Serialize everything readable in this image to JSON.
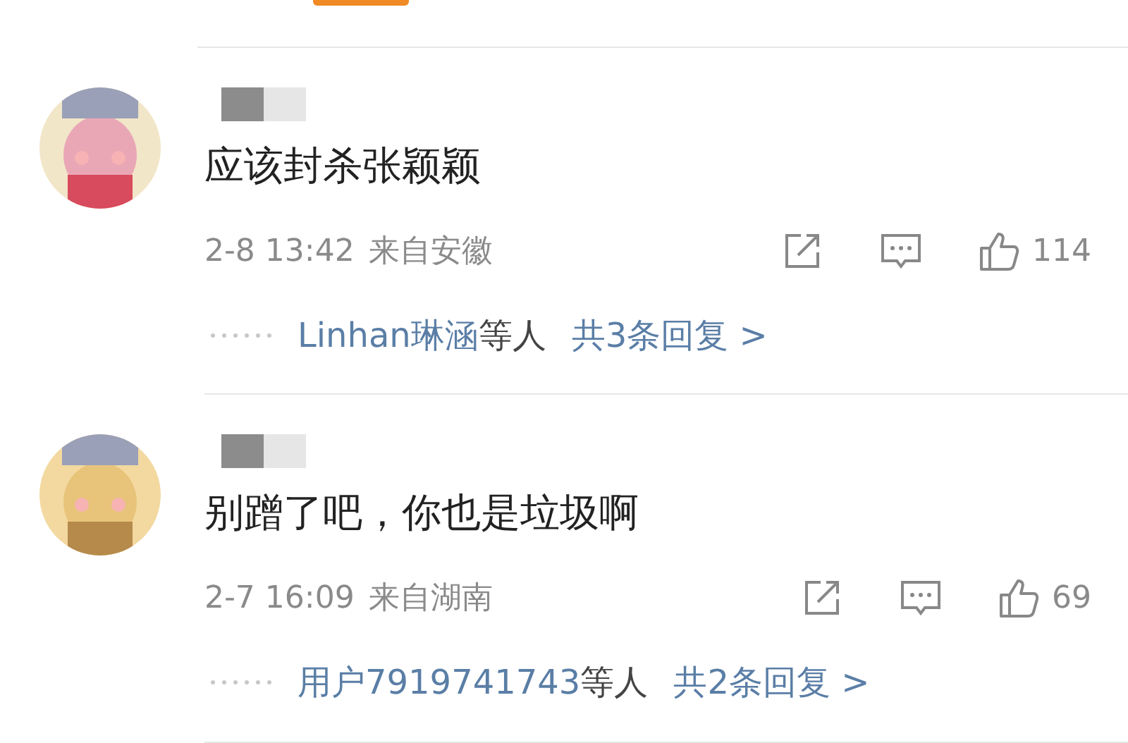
{
  "comments": [
    {
      "text": "应该封杀张颖颖",
      "time": "2-8 13:42",
      "location": "来自安徽",
      "likes": "114",
      "replies": {
        "users": "Linhan琳涵",
        "suffix": "等人",
        "total": "共3条回复 >"
      }
    },
    {
      "text": "别蹭了吧，你也是垃圾啊",
      "time": "2-7 16:09",
      "location": "来自湖南",
      "likes": "69",
      "replies": {
        "users": "用户7919741743",
        "suffix": "等人",
        "total": "共2条回复 >"
      }
    }
  ]
}
